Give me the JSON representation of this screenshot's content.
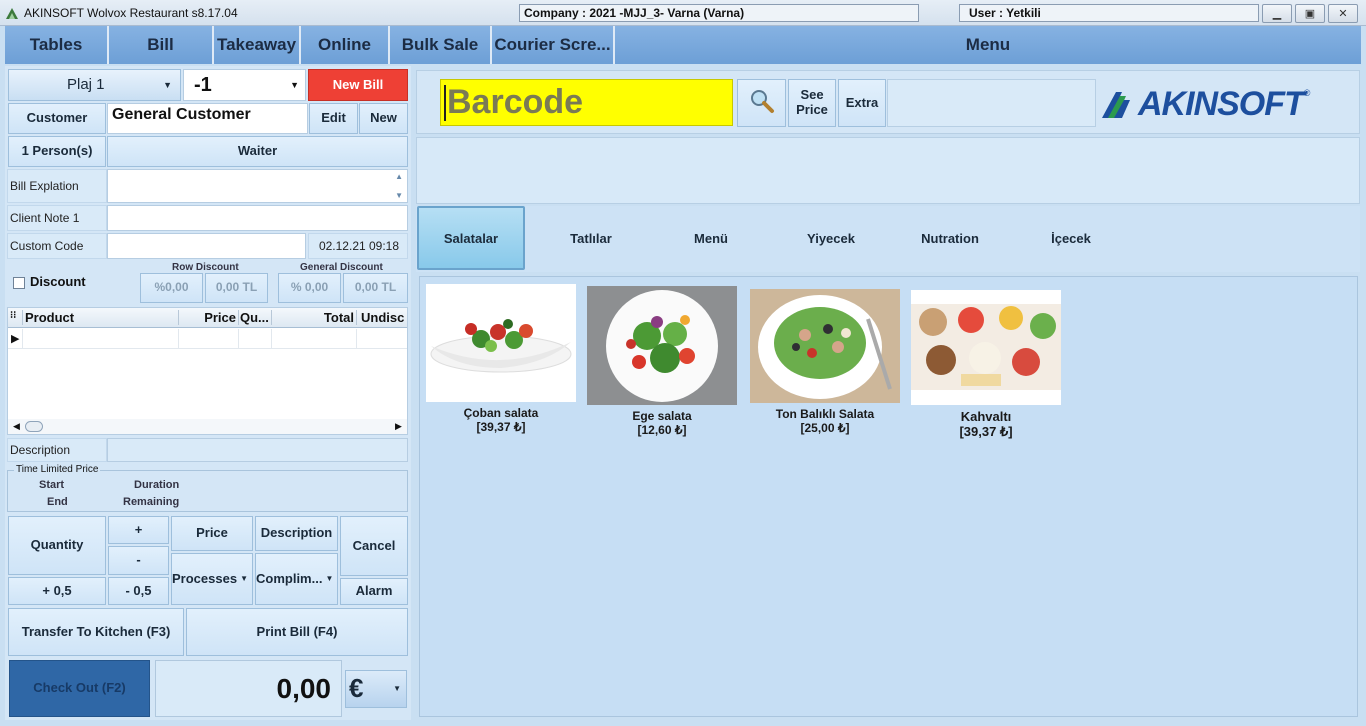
{
  "window": {
    "title": "AKINSOFT Wolvox Restaurant s8.17.04",
    "company": "Company : 2021 -MJJ_3- Varna (Varna)",
    "user": "User : Yetkili",
    "minimize_glyph": "▁",
    "maximize_glyph": "▣",
    "close_glyph": "✕"
  },
  "nav": {
    "items": [
      "Tables",
      "Bill",
      "Takeaway",
      "Online",
      "Bulk Sale",
      "Courier Scre...",
      "Menu"
    ]
  },
  "bill": {
    "table_select": "Plaj 1",
    "bill_number": "-1",
    "new_bill_label": "New Bill",
    "customer_label": "Customer",
    "customer_value": "General Customer",
    "edit_label": "Edit",
    "new_label": "New",
    "persons_label": "1 Person(s)",
    "waiter_label": "Waiter",
    "bill_explanation_label": "Bill Explation",
    "client_note_label": "Client Note 1",
    "custom_code_label": "Custom Code",
    "datetime": "02.12.21 09:18",
    "discount_label": "Discount",
    "row_discount_label": "Row Discount",
    "general_discount_label": "General Discount",
    "row_discount_percent": "%0,00",
    "row_discount_amount": "0,00 TL",
    "general_discount_percent": "% 0,00",
    "general_discount_amount": "0,00 TL"
  },
  "grid": {
    "columns": [
      "Product",
      "Price",
      "Qu...",
      "Total",
      "Undisc"
    ]
  },
  "bottom": {
    "description_label": "Description",
    "time_limited_label": "Time Limited Price",
    "start_label": "Start",
    "duration_label": "Duration",
    "end_label": "End",
    "remaining_label": "Remaining",
    "quantity_label": "Quantity",
    "plus_label": "+",
    "minus_label": "-",
    "price_label": "Price",
    "description_btn_label": "Description",
    "cancel_label": "Cancel",
    "processes_label": "Processes",
    "compliment_label": "Complim...",
    "plus_half_label": "+ 0,5",
    "minus_half_label": "- 0,5",
    "alarm_label": "Alarm",
    "transfer_label": "Transfer To Kitchen (F3)",
    "print_label": "Print Bill (F4)",
    "checkout_label": "Check Out (F2)",
    "total": "0,00",
    "currency": "€"
  },
  "search": {
    "barcode_placeholder": "Barcode",
    "see_price_label": "See Price",
    "extra_label": "Extra",
    "logo_text": "AKINSOFT",
    "logo_mark": "®"
  },
  "categories": [
    "Salatalar",
    "Tatlılar",
    "Menü",
    "Yiyecek",
    "Nutration",
    "İçecek"
  ],
  "products": [
    {
      "name": "Çoban salata",
      "price": "[39,37 ₺]"
    },
    {
      "name": "Ege salata",
      "price": "[12,60 ₺]"
    },
    {
      "name": "Ton Balıklı Salata",
      "price": "[25,00 ₺]"
    },
    {
      "name": "Kahvaltı",
      "price": "[39,37 ₺]"
    }
  ],
  "colors": {
    "nav_blue": "#6fa1d8",
    "new_bill_red": "#ee4035",
    "barcode_yellow": "#ffff00",
    "checkout_blue": "#2f67a6",
    "logo_blue": "#1d4f9e"
  }
}
